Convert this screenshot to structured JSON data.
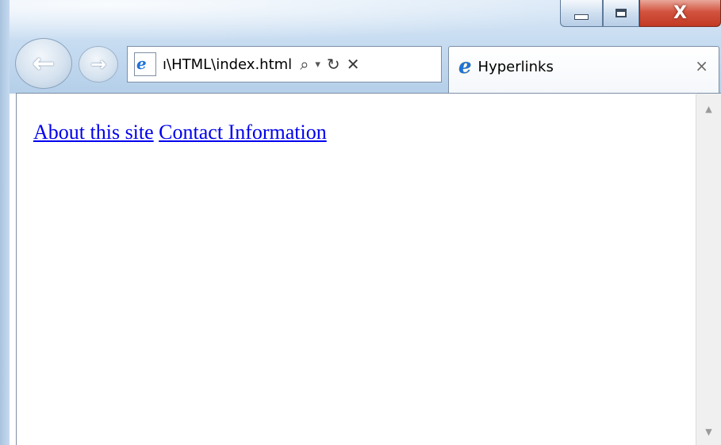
{
  "window": {
    "caption": {
      "close_glyph": "X"
    }
  },
  "nav": {
    "back_icon": "back-arrow-icon",
    "forward_icon": "forward-arrow-icon"
  },
  "address_bar": {
    "value": "ı\\HTML\\index.html",
    "search_icon": "search-icon",
    "dropdown_icon": "dropdown-icon",
    "refresh_icon": "refresh-icon",
    "stop_icon": "stop-icon"
  },
  "tab": {
    "title": "Hyperlinks",
    "close_glyph": "×"
  },
  "content": {
    "links": [
      {
        "label": "About this site"
      },
      {
        "label": "Contact Information"
      }
    ]
  },
  "colors": {
    "link": "#0000ee",
    "close_button": "#c23a24",
    "ie_blue": "#1d73d8"
  }
}
